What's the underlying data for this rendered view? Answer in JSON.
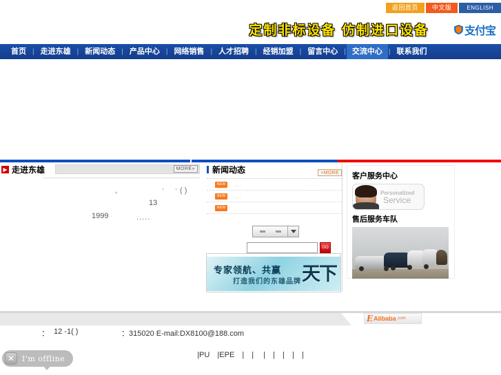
{
  "topbar": {
    "buttons": [
      {
        "label": "返回首页",
        "color": "#f2a01e"
      },
      {
        "label": "中文版",
        "color": "#f25a1e"
      },
      {
        "label": "ENGLISH",
        "color": "#2b5ea7"
      }
    ]
  },
  "banner": {
    "slogan": "定制非标设备  仿制进口设备",
    "slogan_color": "#ffe400",
    "alipay_label": "支付宝"
  },
  "nav": {
    "items": [
      {
        "label": "首页",
        "active": false
      },
      {
        "label": "走进东雄",
        "active": false
      },
      {
        "label": "新闻动态",
        "active": false
      },
      {
        "label": "产品中心",
        "active": false
      },
      {
        "label": "网络销售",
        "active": false
      },
      {
        "label": "人才招聘",
        "active": false
      },
      {
        "label": "经销加盟",
        "active": false
      },
      {
        "label": "留言中心",
        "active": false
      },
      {
        "label": "交流中心",
        "active": true
      },
      {
        "label": "联系我们",
        "active": false
      }
    ],
    "separator": "|",
    "bg_color": "#17459a",
    "active_color": "#2f6ec6"
  },
  "dividers": {
    "blue": "#0b4fc0",
    "red": "#f20000"
  },
  "about_panel": {
    "title": "走进东雄",
    "more_label": "MORE»",
    "fragments": {
      "f1": ",",
      "f2": "· ·",
      "f3": "( )",
      "f4": "13",
      "f5": "1999",
      "f6": "....."
    }
  },
  "news_panel": {
    "title": "新闻动态",
    "more_label": "+MORE",
    "rows": [
      {
        "badge": "NEW",
        "dots": "..."
      },
      {
        "badge": "NEW",
        "dots": "..."
      },
      {
        "badge": "NEW",
        "dots": ""
      }
    ]
  },
  "search": {
    "select_value": "",
    "input_value": "",
    "input_placeholder": "",
    "go_label": "GO"
  },
  "ad_banner": {
    "line1": "专家领航、共赢",
    "line2": "打造我们的东雄品牌",
    "big": "天下"
  },
  "sidebar": {
    "service_title": "客户服务中心",
    "service_img_line1": "Personalized",
    "service_img_line2": "Service",
    "fleet_title": "售后服务车队"
  },
  "footer": {
    "colon": "：",
    "address_fragment": "12 -1(    )",
    "zip_email": "：315020  E-mail:DX8100@188.com",
    "alibaba_mark": "E",
    "alibaba_text": "Alibaba",
    "alibaba_com": ".com"
  },
  "keywords": {
    "items": [
      "|PU",
      "|EPE",
      "|",
      "|",
      "|",
      "|",
      "|",
      "|",
      "|"
    ]
  },
  "chat": {
    "close_label": "✕",
    "status_label": "I'm offline"
  }
}
